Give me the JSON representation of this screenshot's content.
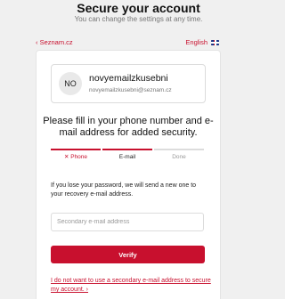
{
  "header": {
    "title": "Secure your account",
    "subtitle": "You can change the settings at any time."
  },
  "topbar": {
    "back_label": "‹ Seznam.cz",
    "language_label": "English"
  },
  "account": {
    "initials": "NO",
    "name": "novyemailzkusebni",
    "email": "novyemailzkusebni@seznam.cz"
  },
  "lead_text": "Please fill in your phone number and e-mail address for added security.",
  "steps": [
    {
      "label": "Phone",
      "state": "skipped",
      "icon": "cross-icon"
    },
    {
      "label": "E-mail",
      "state": "active"
    },
    {
      "label": "Done",
      "state": "pending"
    }
  ],
  "info_text": "If you lose your password, we will send a new one to your recovery e-mail address.",
  "recovery_email": {
    "value": "",
    "placeholder": "Secondary e-mail address"
  },
  "verify_label": "Verify",
  "skip_link": "I do not want to use a secondary e-mail address to secure my account. ›",
  "colors": {
    "accent": "#c8102e",
    "background": "#f0f0f0",
    "card": "#ffffff"
  }
}
